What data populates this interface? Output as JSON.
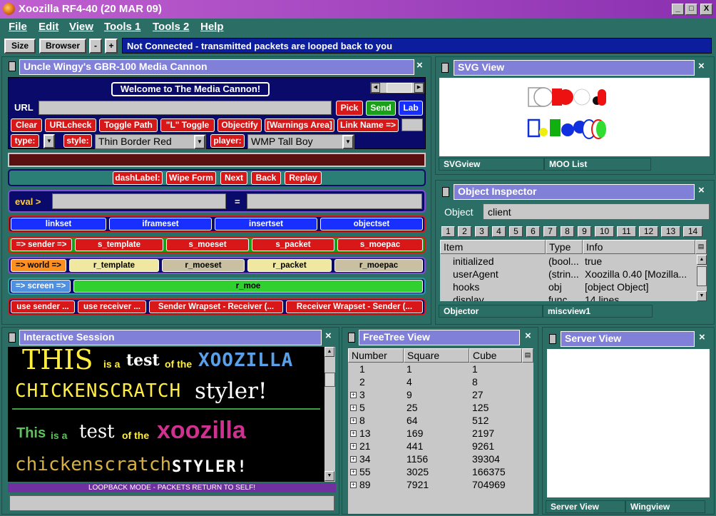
{
  "window": {
    "title": "Xoozilla RF4-40 (20 MAR 09)",
    "min": "_",
    "max": "□",
    "close": "X"
  },
  "menu": [
    "File",
    "Edit",
    "View",
    "Tools 1",
    "Tools 2",
    "Help"
  ],
  "toolbar": {
    "size": "Size",
    "browser": "Browser",
    "minus": "-",
    "plus": "+",
    "status": "Not Connected - transmitted packets are looped back to you"
  },
  "cannon": {
    "title": "Uncle Wingy's GBR-100 Media Cannon",
    "welcome": "Welcome to The Media Cannon!",
    "url_label": "URL",
    "url_value": "",
    "pick": "Pick",
    "send": "Send",
    "lab": "Lab",
    "row2": [
      "Clear",
      "URLcheck",
      "Toggle Path",
      "\"L\" Toggle",
      "Objectify",
      "[Warnings Area]",
      "Link Name =>"
    ],
    "type_label": "type:",
    "style_label": "style:",
    "style_value": "Thin Border Red",
    "player_label": "player:",
    "player_value": "WMP Tall Boy",
    "dash": [
      "dashLabel:",
      "Wipe Form",
      "Next",
      "Back",
      "Replay"
    ],
    "eval_label": "eval >",
    "equals": "=",
    "sets": [
      "linkset",
      "iframeset",
      "insertset",
      "objectset"
    ],
    "sender_label": "=> sender =>",
    "sender": [
      "s_template",
      "s_moeset",
      "s_packet",
      "s_moepac"
    ],
    "world_label": "=> world =>",
    "world": [
      "r_template",
      "r_moeset",
      "r_packet",
      "r_moepac"
    ],
    "screen_label": "=> screen =>",
    "screen": "r_moe",
    "bottom": [
      "use sender ...",
      "use receiver ...",
      "Sender Wrapset - Receiver (...",
      "Receiver Wrapset - Sender (..."
    ]
  },
  "svgview": {
    "title": "SVG View",
    "tabs": [
      "SVGview",
      "MOO List"
    ]
  },
  "inspector": {
    "title": "Object Inspector",
    "object_label": "Object",
    "object_value": "client",
    "numtabs": [
      "1",
      "2",
      "3",
      "4",
      "5",
      "6",
      "7",
      "8",
      "9",
      "10",
      "11",
      "12",
      "13",
      "14"
    ],
    "headers": [
      "Item",
      "Type",
      "Info"
    ],
    "rows": [
      [
        "initialized",
        "(bool...",
        "true"
      ],
      [
        "userAgent",
        "(strin...",
        "Xoozilla 0.40 [Mozilla..."
      ],
      [
        "hooks",
        "obj",
        "[object Object]"
      ],
      [
        "display",
        "func",
        "14 lines"
      ]
    ],
    "tabs": [
      "Objector",
      "miscview1"
    ]
  },
  "session": {
    "title": "Interactive Session",
    "line1": {
      "big": "THIS",
      "small1": "is a",
      "mid": "test",
      "small2": "of the",
      "brand": "XOOZILLA"
    },
    "line2": {
      "a": "CHICKENSCRATCH",
      "b": "styler!"
    },
    "line3": {
      "a": "This",
      "b": "is a",
      "c": "test",
      "d": "of the",
      "e": "xoozilla"
    },
    "line4": {
      "a": "chickenscratch",
      "b": "STYLER!"
    },
    "footer": "LOOPBACK MODE - PACKETS RETURN TO SELF!"
  },
  "freetree": {
    "title": "FreeTree View",
    "headers": [
      "Number",
      "Square",
      "Cube"
    ],
    "rows": [
      [
        "1",
        "1",
        "1",
        false
      ],
      [
        "2",
        "4",
        "8",
        false
      ],
      [
        "3",
        "9",
        "27",
        true
      ],
      [
        "5",
        "25",
        "125",
        true
      ],
      [
        "8",
        "64",
        "512",
        true
      ],
      [
        "13",
        "169",
        "2197",
        true
      ],
      [
        "21",
        "441",
        "9261",
        true
      ],
      [
        "34",
        "1156",
        "39304",
        true
      ],
      [
        "55",
        "3025",
        "166375",
        true
      ],
      [
        "89",
        "7921",
        "704969",
        true
      ]
    ]
  },
  "server": {
    "title": "Server View",
    "tabs": [
      "Server View",
      "Wingview"
    ]
  },
  "colors": {
    "teal": "#2a6e66",
    "title_purple": "#a040c0",
    "header_lavender": "#8080d8",
    "status_blue": "#0c1e9e",
    "cannon_navy": "#0a0a6a",
    "red": "#d81818",
    "green": "#18a018",
    "blue": "#1830ff"
  }
}
